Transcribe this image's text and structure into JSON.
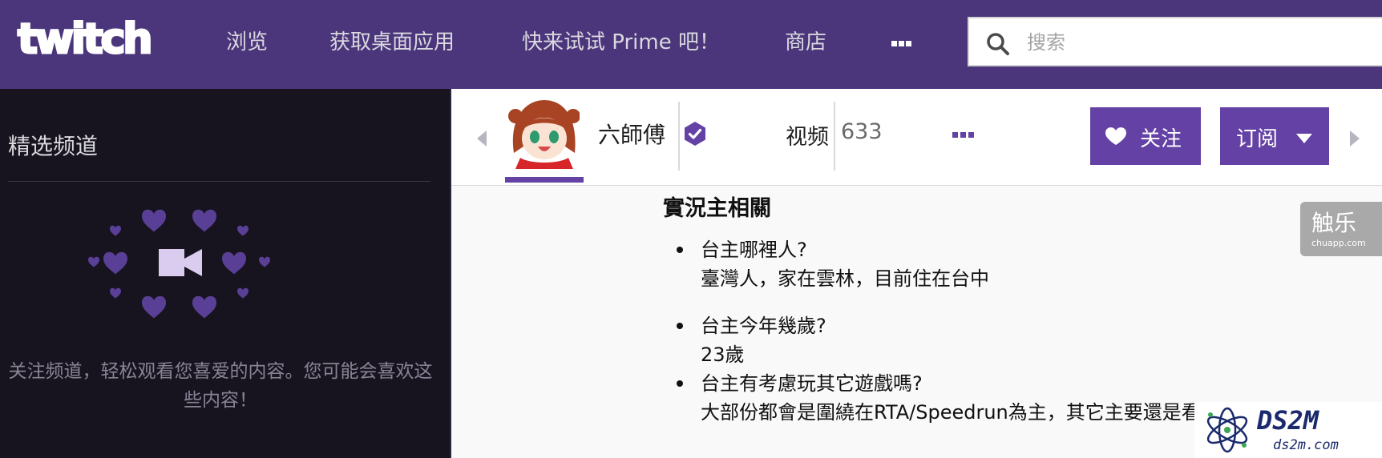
{
  "header": {
    "logo_text": "twitch",
    "nav": [
      {
        "label": "浏览"
      },
      {
        "label": "获取桌面应用"
      },
      {
        "label": "快来试试 Prime 吧！"
      },
      {
        "label": "商店"
      }
    ],
    "more_icon": "ellipsis-icon",
    "search": {
      "placeholder": "搜索",
      "value": "",
      "icon": "search-icon"
    }
  },
  "sidebar": {
    "title": "精选频道",
    "illustration_icon": "video-camera-icon",
    "message": "关注频道，轻松观看您喜爱的内容。您可能会喜欢这些内容！"
  },
  "channel": {
    "name": "六師傅",
    "verified": true,
    "videos_label": "视频",
    "videos_count": "633",
    "follow_label": "关注",
    "subscribe_label": "订阅"
  },
  "content": {
    "title": "實況主相關",
    "faq": [
      {
        "q": "台主哪裡人?",
        "a": "臺灣人，家在雲林，目前住在台中"
      },
      {
        "q": "台主今年幾歲?",
        "a": "23歲"
      },
      {
        "q": "台主有考慮玩其它遊戲嗎?",
        "a": "大部份都會是圍繞在RTA/Speedrun為主，其它主要還是看"
      }
    ]
  },
  "watermarks": {
    "chuapp_big": "触乐",
    "chuapp_small": "chuapp.com",
    "ds2m_big": "DS2M",
    "ds2m_small": "ds2m.com"
  },
  "colors": {
    "nav_bg": "#4b367c",
    "accent": "#6441a4",
    "sidebar_bg": "#17141f"
  }
}
